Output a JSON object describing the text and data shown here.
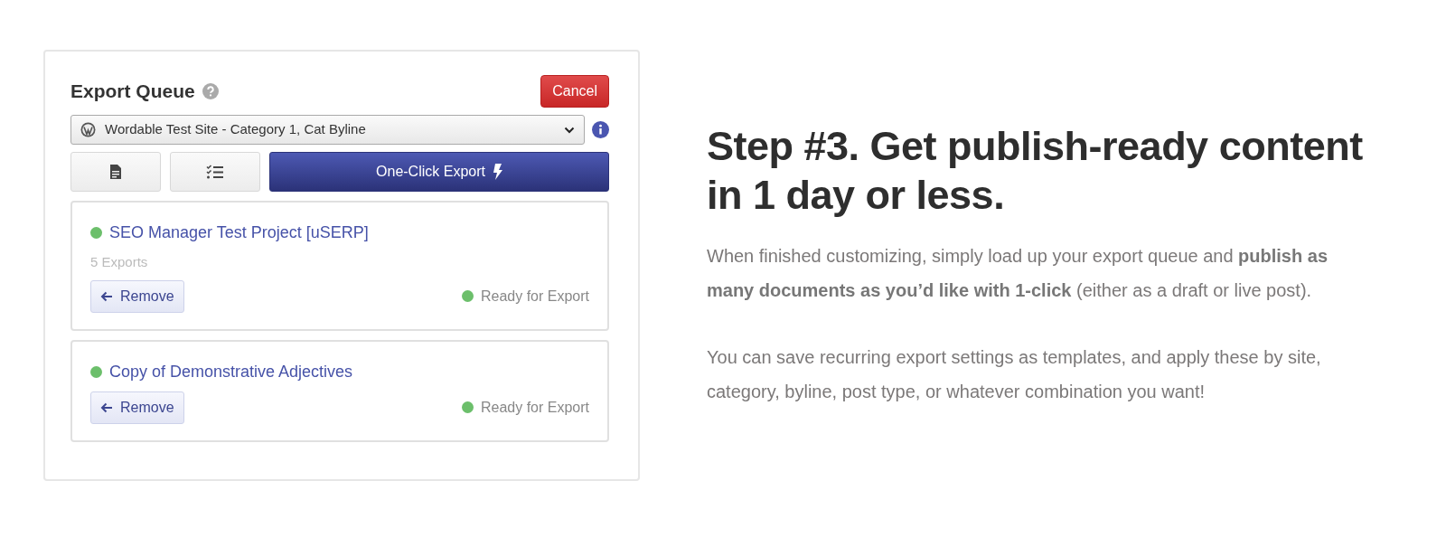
{
  "panel": {
    "title": "Export Queue",
    "cancel": "Cancel",
    "site_select": {
      "value": "Wordable Test Site - Category 1, Cat Byline"
    },
    "export_button": "One-Click Export",
    "items": [
      {
        "title": "SEO Manager Test Project [uSERP]",
        "subtitle": "5 Exports",
        "remove": "Remove",
        "status": "Ready for Export"
      },
      {
        "title": "Copy of Demonstrative Adjectives",
        "remove": "Remove",
        "status": "Ready for Export"
      }
    ]
  },
  "article": {
    "heading": "Step #3. Get publish-ready content in 1 day or less.",
    "paragraphs": [
      "When finished customizing, simply load up your export queue and **publish as many documents as you’d like with 1-click** (either as a draft or live post).",
      "You can save recurring export settings as templates, and apply these by site, category, byline, post type, or whatever combination you want!"
    ]
  }
}
